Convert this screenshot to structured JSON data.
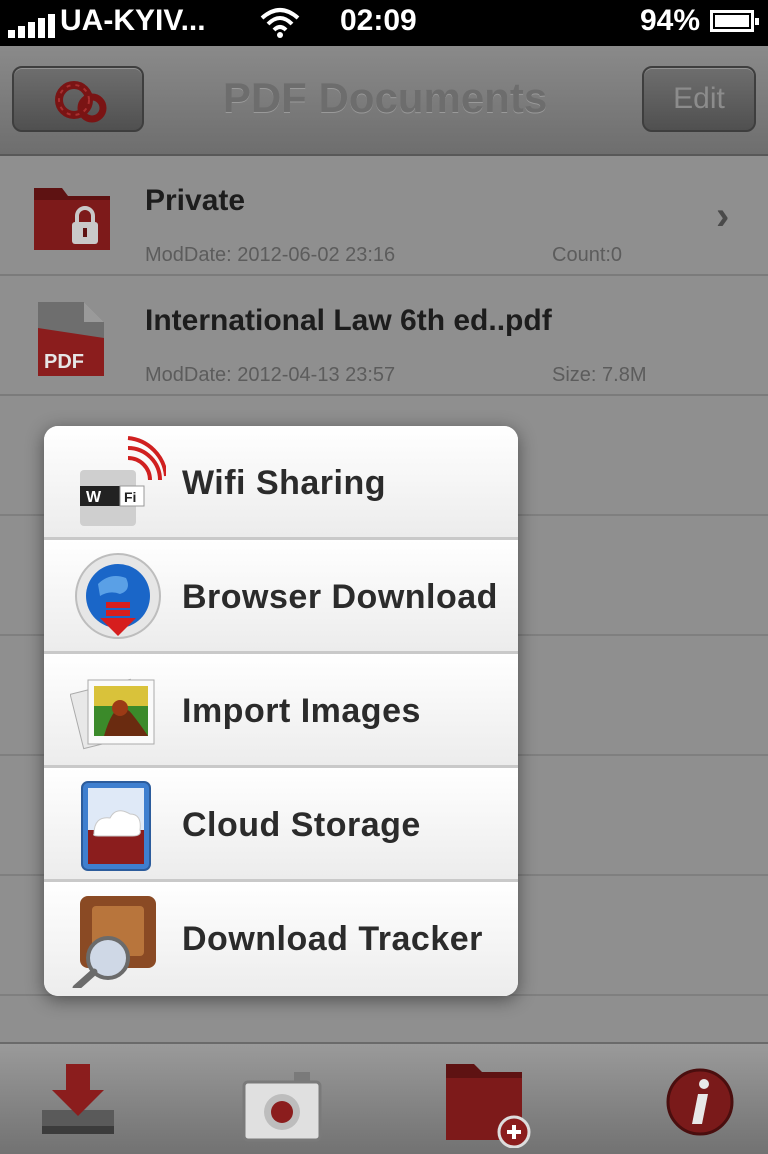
{
  "status_bar": {
    "carrier": "UA-KYIV...",
    "time": "02:09",
    "battery": "94%"
  },
  "nav": {
    "title": "PDF Documents",
    "edit_label": "Edit",
    "settings_icon": "gears-icon"
  },
  "files": [
    {
      "name": "Private",
      "mod_date": "ModDate: 2012-06-02 23:16",
      "meta": "Count:0",
      "type": "folder",
      "icon": "locked-folder-icon"
    },
    {
      "name": "International Law 6th ed..pdf",
      "mod_date": "ModDate: 2012-04-13 23:57",
      "meta": "Size: 7.8M",
      "type": "pdf",
      "icon": "pdf-file-icon",
      "icon_text": "PDF"
    }
  ],
  "menu": {
    "items": [
      {
        "label": "Wifi Sharing",
        "icon": "wifi-sharing-icon",
        "icon_text": [
          "W",
          "Fi"
        ]
      },
      {
        "label": "Browser Download",
        "icon": "browser-download-icon"
      },
      {
        "label": "Import Images",
        "icon": "import-images-icon"
      },
      {
        "label": "Cloud Storage",
        "icon": "cloud-storage-icon"
      },
      {
        "label": "Download Tracker",
        "icon": "download-tracker-icon"
      }
    ]
  },
  "tabbar": {
    "items": [
      {
        "icon": "download-tray-icon"
      },
      {
        "icon": "camera-icon"
      },
      {
        "icon": "new-folder-icon"
      },
      {
        "icon": "info-icon"
      }
    ]
  },
  "colors": {
    "accent_red": "#8b1d1d",
    "overlay_gray": "#8f8f8f",
    "menu_bg": "#f4f4f4"
  }
}
